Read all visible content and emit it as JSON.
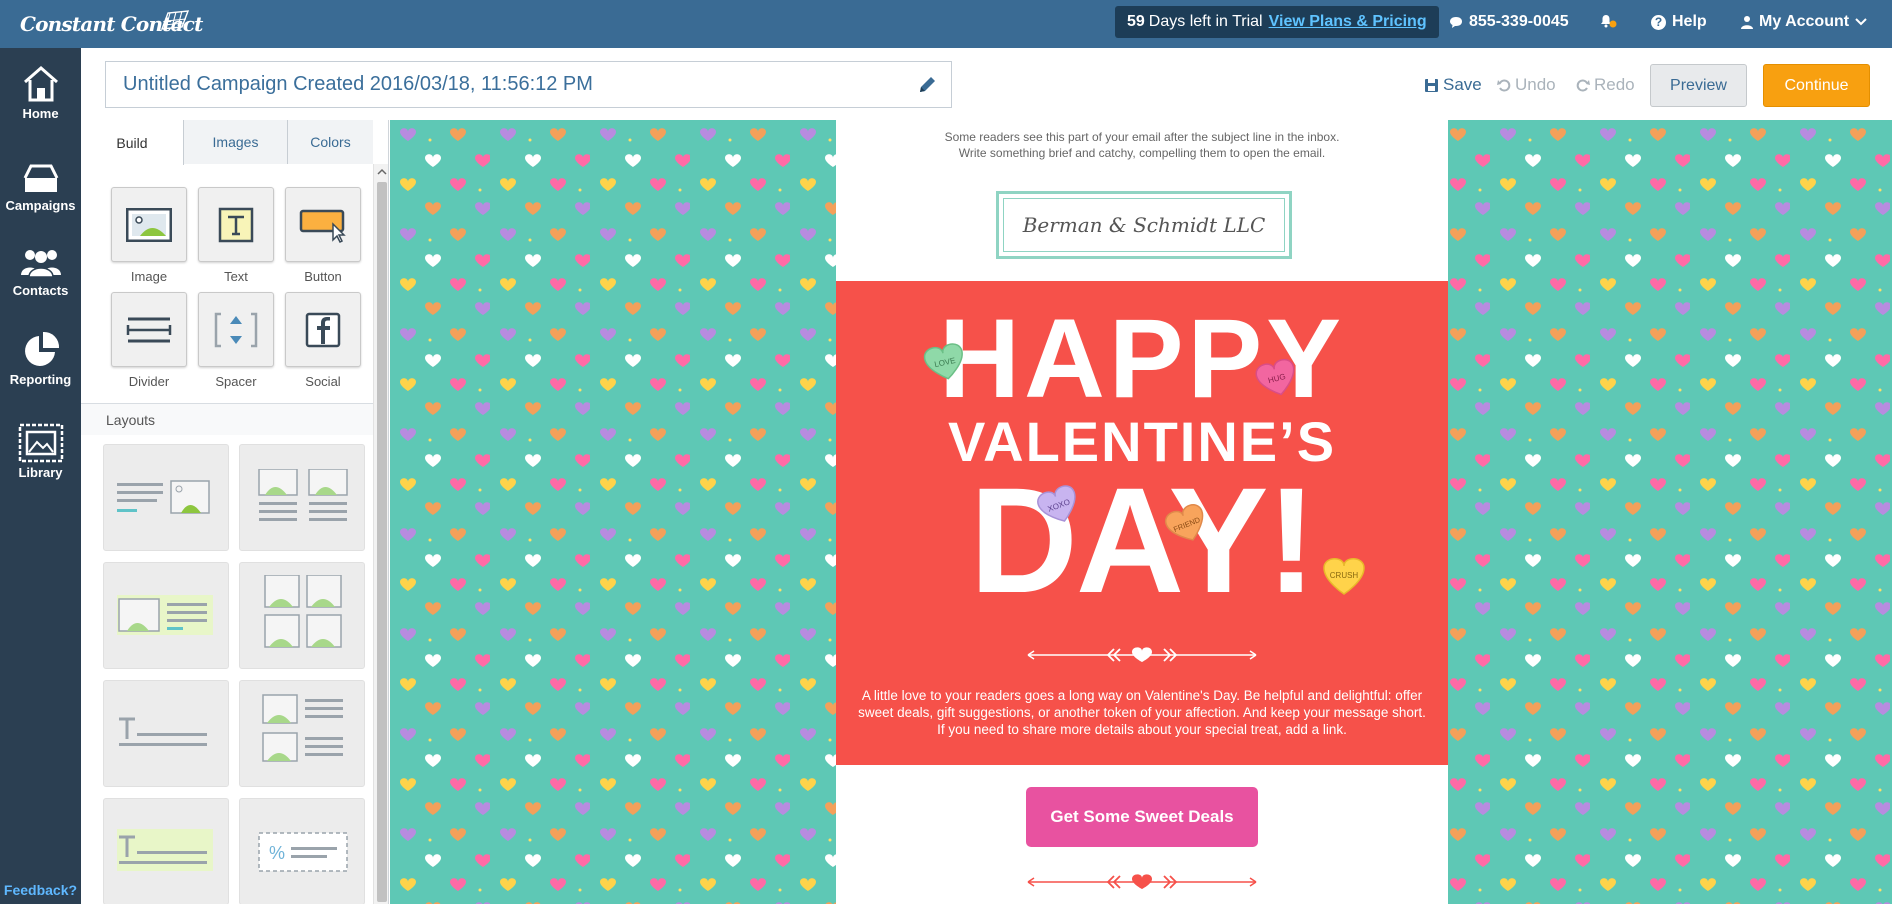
{
  "app": {
    "logo_text": "Constant Contact",
    "trial_days": "59",
    "trial_text": "Days left in Trial",
    "trial_link": "View Plans & Pricing",
    "phone": "855-339-0045",
    "help": "Help",
    "account": "My Account"
  },
  "nav": {
    "items": [
      {
        "label": "Home",
        "icon": "home-icon"
      },
      {
        "label": "Campaigns",
        "icon": "campaigns-icon"
      },
      {
        "label": "Contacts",
        "icon": "contacts-icon"
      },
      {
        "label": "Reporting",
        "icon": "reporting-icon"
      },
      {
        "label": "Library",
        "icon": "library-icon"
      }
    ],
    "feedback": "Feedback?"
  },
  "editor": {
    "campaign_title": "Untitled Campaign Created 2016/03/18, 11:56:12 PM",
    "save": "Save",
    "undo": "Undo",
    "redo": "Redo",
    "preview": "Preview",
    "continue": "Continue"
  },
  "panel": {
    "tabs": [
      "Build",
      "Images",
      "Colors"
    ],
    "active_tab": "Build",
    "blocks": [
      {
        "label": "Image",
        "icon": "image-block-icon"
      },
      {
        "label": "Text",
        "icon": "text-block-icon"
      },
      {
        "label": "Button",
        "icon": "button-block-icon"
      },
      {
        "label": "Divider",
        "icon": "divider-block-icon"
      },
      {
        "label": "Spacer",
        "icon": "spacer-block-icon"
      },
      {
        "label": "Social",
        "icon": "social-block-icon"
      }
    ],
    "layouts_heading": "Layouts"
  },
  "email": {
    "preheader_line1": "Some readers see this part of your email after the subject line in the inbox.",
    "preheader_line2": "Write something brief and catchy, compelling them to open the email.",
    "logo_text": "Berman & Schmidt LLC",
    "hero_line1": "HAPPY",
    "hero_line2": "VALENTINE’S",
    "hero_line3": "DAY!",
    "candy_labels": [
      "LOVE",
      "HUG",
      "XOXO",
      "FRIEND",
      "CRUSH"
    ],
    "body": "A little love to your readers goes a long way on Valentine's Day. Be helpful and delightful: offer sweet deals, gift suggestions, or another token of your affection. And keep your message short. If you need to share more details about your special treat, add a link.",
    "cta": "Get Some Sweet Deals"
  },
  "colors": {
    "topbar": "#3a6b94",
    "leftnav": "#2b3f52",
    "hero_red": "#f6514a",
    "cta_pink": "#e852a0",
    "continue_orange": "#f8a010",
    "pattern_teal": "#5ec8b5"
  }
}
